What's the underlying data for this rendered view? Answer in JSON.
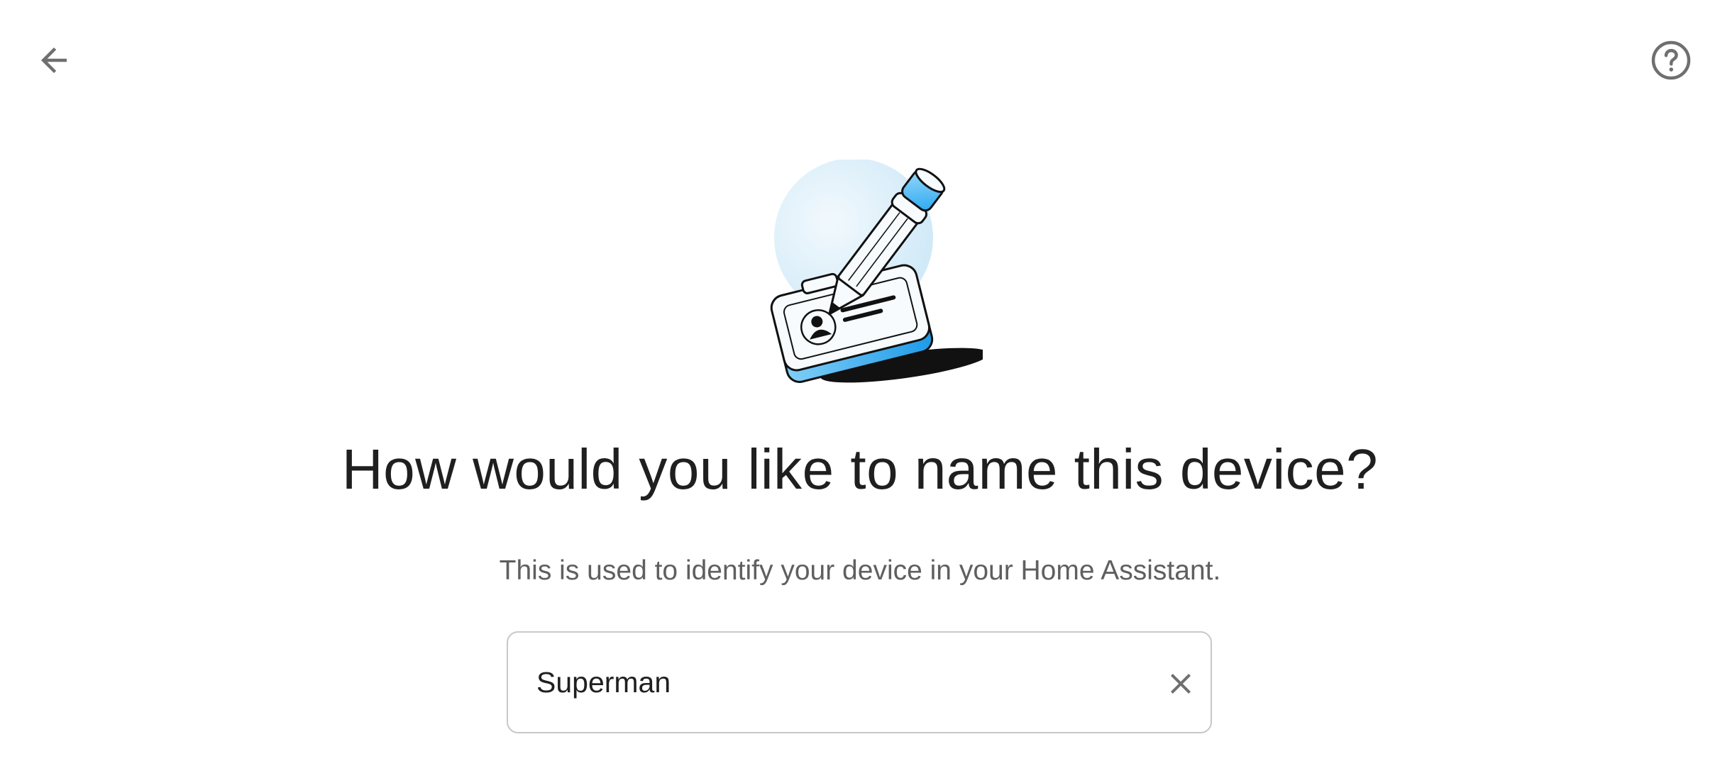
{
  "header": {
    "back_icon": "arrow-left-icon",
    "help_icon": "help-circle-icon"
  },
  "illustration": {
    "icon": "pencil-id-card-illustration"
  },
  "main": {
    "title": "How would you like to name this device?",
    "subtitle": "This is used to identify your device in your Home Assistant.",
    "name_field": {
      "value": "Superman",
      "clear_icon": "close-icon"
    }
  },
  "colors": {
    "accent_blue": "#2aa8f0",
    "light_blue": "#d8eefa",
    "icon_gray": "#6f6f6f",
    "text_dark": "#1f1f1f",
    "text_secondary": "#5f5f5f",
    "border": "#c8c8c8"
  }
}
